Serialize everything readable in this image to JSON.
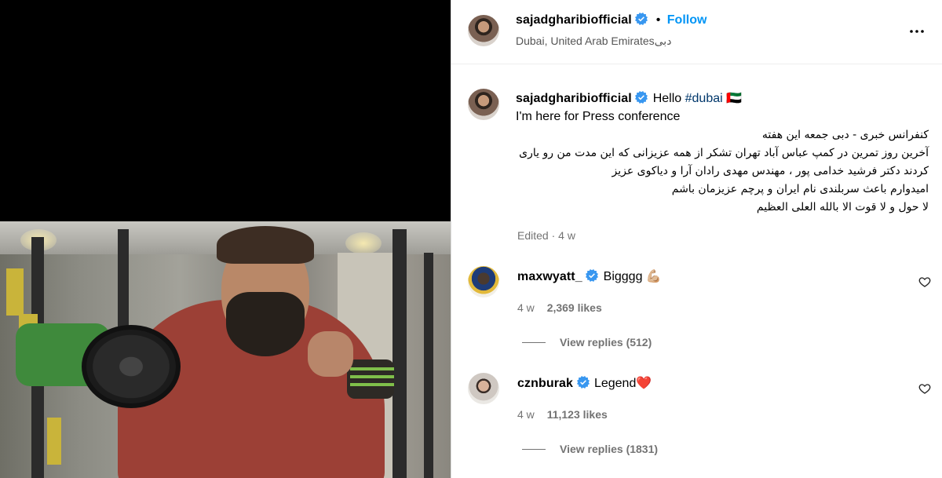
{
  "header": {
    "username": "sajadgharibiofficial",
    "separator": "•",
    "follow_label": "Follow",
    "location": "Dubai, United Arab Emiratesدبی"
  },
  "caption": {
    "username": "sajadgharibiofficial",
    "greeting": "Hello ",
    "hashtag": "#dubai",
    "flag": "🇦🇪",
    "line2": "I'm here for Press conference",
    "fa_line1": "کنفرانس خبری - دبی جمعه این هفته",
    "fa_line2": "آخرین روز تمرین در کمپ عباس آباد تهران تشکر از همه عزیزانی که این مدت من رو یاری",
    "fa_line3": "کردند دکتر فرشید خدامی پور ، مهندس مهدی رادان آرا و دیاکوی عزیز",
    "fa_line4": "امیدوارم باعث سربلندی نام ایران و پرچم عزیزمان باشم",
    "fa_line5": "لا حول و لا قوت الا بالله العلی العظیم",
    "edited": "Edited",
    "dot": "·",
    "time": "4 w"
  },
  "comments": [
    {
      "username": "maxwyatt_",
      "text": "Bigggg 💪🏼",
      "time": "4 w",
      "likes": "2,369 likes",
      "view_replies": "View replies (512)"
    },
    {
      "username": "cznburak",
      "text": "Legend❤️",
      "time": "4 w",
      "likes": "11,123 likes",
      "view_replies": "View replies (1831)"
    }
  ],
  "icons": {
    "verified": "verified-badge-icon",
    "more": "more-options-icon",
    "like": "heart-icon"
  },
  "colors": {
    "follow": "#0095f6",
    "verified": "#3897f0",
    "meta": "#737373"
  }
}
